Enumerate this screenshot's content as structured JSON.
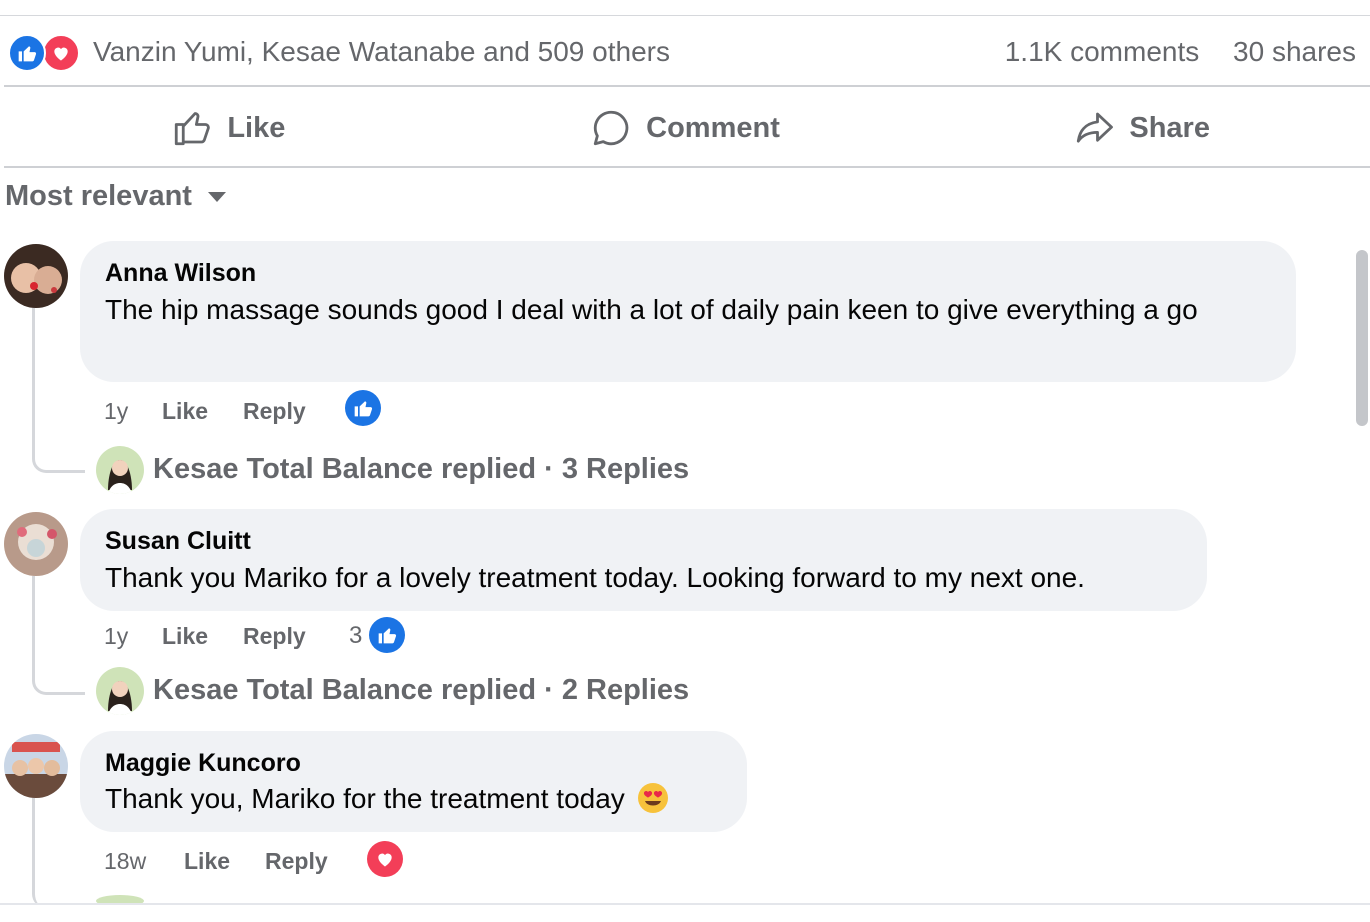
{
  "summary": {
    "reactions_text": "Vanzin Yumi, Kesae Watanabe and 509 others",
    "comments_count": "1.1K comments",
    "shares_count": "30 shares",
    "reaction_icons": [
      "like-icon",
      "love-icon"
    ]
  },
  "actions": {
    "like": "Like",
    "comment": "Comment",
    "share": "Share"
  },
  "filter": {
    "label": "Most relevant"
  },
  "comments": [
    {
      "author": "Anna Wilson",
      "text": "The hip massage sounds good I deal with a lot of daily pain keen to give everything a go",
      "time": "1y",
      "like_label": "Like",
      "reply_label": "Reply",
      "reaction": "like-icon",
      "reaction_count": "",
      "replies": {
        "text": "Kesae Total Balance replied · 3 Replies"
      }
    },
    {
      "author": "Susan Cluitt",
      "text": "Thank you Mariko for a lovely treatment today. Looking forward to my next one.",
      "time": "1y",
      "like_label": "Like",
      "reply_label": "Reply",
      "reaction": "like-icon",
      "reaction_count": "3",
      "replies": {
        "text": "Kesae Total Balance replied · 2 Replies"
      }
    },
    {
      "author": "Maggie Kuncoro",
      "text": "Thank you, Mariko for the treatment today",
      "emoji": "heart-eyes-emoji",
      "time": "18w",
      "like_label": "Like",
      "reply_label": "Reply",
      "reaction": "love-icon",
      "reaction_count": ""
    }
  ],
  "colors": {
    "like_blue": "#1b74e4",
    "love_red": "#f33e58",
    "bubble_bg": "#f0f2f5",
    "secondary_text": "#65676b"
  }
}
